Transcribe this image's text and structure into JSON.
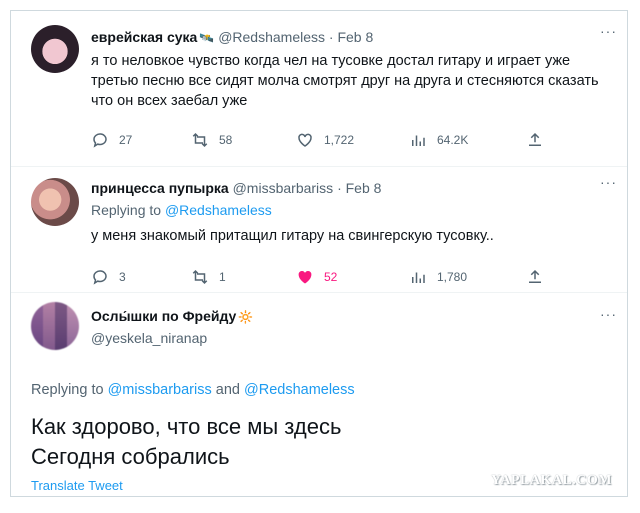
{
  "tweets": [
    {
      "name": "еврейская сука",
      "badge": "🛰️",
      "handle": "@Redshameless",
      "date": "Feb 8",
      "text": "я то неловкое чувство когда чел на тусовке достал гитару и играет уже третью песню все сидят молча смотрят друг на друга и стесняются сказать что он всех заебал уже",
      "replies": "27",
      "retweets": "58",
      "likes": "1,722",
      "views": "64.2K"
    },
    {
      "name": "принцесса пупырка",
      "handle": "@missbarbariss",
      "date": "Feb 8",
      "replying_prefix": "Replying to",
      "replying_to": "@Redshameless",
      "text": "у меня знакомый притащил гитару на свингерскую тусовку..",
      "replies": "3",
      "retweets": "1",
      "likes": "52",
      "views": "1,780"
    },
    {
      "name": "Ослы́шки по Фрейду",
      "badge": "🔆",
      "handle": "@yeskela_niranap",
      "replying_prefix": "Replying to",
      "replying_to_1": "@missbarbariss",
      "replying_and": "and",
      "replying_to_2": "@Redshameless",
      "text_line1": "Как здорово, что все мы здесь",
      "text_line2": "Сегодня собрались",
      "translate": "Translate Tweet"
    }
  ],
  "separator": "·",
  "more": "···",
  "watermark": "YAPLAKAL.COM",
  "colors": {
    "link": "#1d9bf0",
    "like": "#f91880",
    "muted": "#536471"
  }
}
